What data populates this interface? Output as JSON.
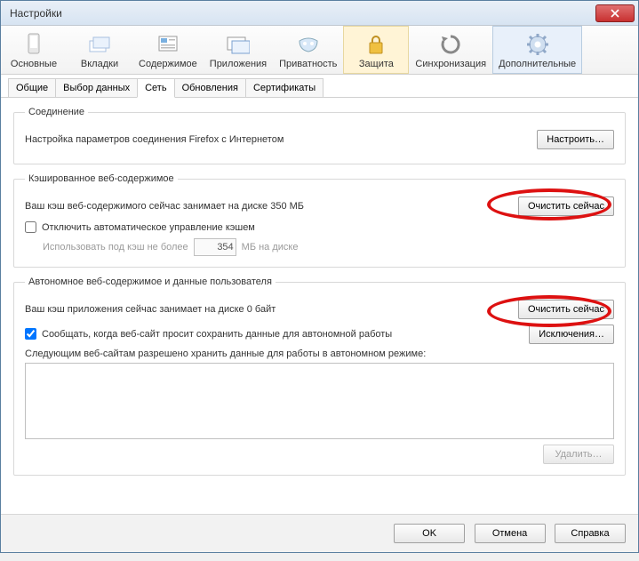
{
  "window": {
    "title": "Настройки"
  },
  "toolbar": {
    "items": [
      {
        "label": "Основные"
      },
      {
        "label": "Вкладки"
      },
      {
        "label": "Содержимое"
      },
      {
        "label": "Приложения"
      },
      {
        "label": "Приватность"
      },
      {
        "label": "Защита"
      },
      {
        "label": "Синхронизация"
      },
      {
        "label": "Дополнительные"
      }
    ]
  },
  "tabs": {
    "items": [
      {
        "label": "Общие"
      },
      {
        "label": "Выбор данных"
      },
      {
        "label": "Сеть"
      },
      {
        "label": "Обновления"
      },
      {
        "label": "Сертификаты"
      }
    ]
  },
  "connection": {
    "legend": "Соединение",
    "text": "Настройка параметров соединения Firefox с Интернетом",
    "configure_btn": "Настроить…"
  },
  "cached": {
    "legend": "Кэшированное веб-содержимое",
    "usage_text": "Ваш кэш веб-содержимого сейчас занимает на диске 350 МБ",
    "clear_btn": "Очистить сейчас",
    "disable_auto": "Отключить автоматическое управление кэшем",
    "limit_prefix": "Использовать под кэш не более",
    "limit_value": "354",
    "limit_suffix": "МБ на диске"
  },
  "offline": {
    "legend": "Автономное веб-содержимое и данные пользователя",
    "usage_text": "Ваш кэш приложения сейчас занимает на диске 0 байт",
    "clear_btn": "Очистить сейчас",
    "notify_check": "Сообщать, когда веб-сайт просит сохранить данные для автономной работы",
    "exceptions_btn": "Исключения…",
    "sites_text": "Следующим веб-сайтам разрешено хранить данные для работы в автономном режиме:",
    "delete_btn": "Удалить…"
  },
  "footer": {
    "ok": "OK",
    "cancel": "Отмена",
    "help": "Справка"
  }
}
